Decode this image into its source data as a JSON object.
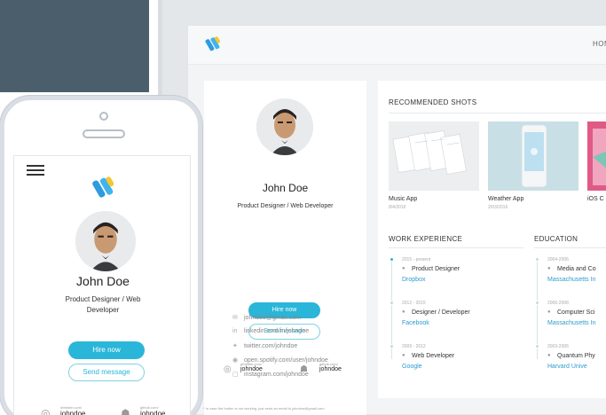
{
  "desktop": {
    "nav_home": "HOME",
    "profile": {
      "name": "John Doe",
      "role": "Product Designer / Web Developer",
      "hire_label": "Hire now",
      "message_label": "Send message",
      "dribbble_caption": "dribbble.com/",
      "dribbble_user": "johndoe",
      "github_caption": "github.com/",
      "github_user": "johndoe"
    },
    "contacts": [
      "johndoe@gmail.com",
      "linkedin.com/in/johndoe",
      "twitter.com/johndoe",
      "open.spotify.com/user/johndoe",
      "instagram.com/johndoe"
    ],
    "recommended_title": "RECOMMENDED SHOTS",
    "shots": [
      {
        "title": "Music App",
        "date": "8/4/2016"
      },
      {
        "title": "Weather App",
        "date": "2/03/2016"
      },
      {
        "title": "iOS C",
        "date": ""
      }
    ],
    "work_title": "WORK EXPERIENCE",
    "work": [
      {
        "dates": "2015 - present",
        "role": "Product Designer",
        "org": "Dropbox"
      },
      {
        "dates": "2012 - 2015",
        "role": "Designer / Developer",
        "org": "Facebook"
      },
      {
        "dates": "2009 - 2012",
        "role": "Web Developer",
        "org": "Google"
      }
    ],
    "education_title": "EDUCATION",
    "education": [
      {
        "dates": "2004-2006",
        "role": "Media and Co",
        "org": "Massachusetts In"
      },
      {
        "dates": "2006-2008",
        "role": "Computer Sci",
        "org": "Massachusetts In"
      },
      {
        "dates": "2003-2006",
        "role": "Quantum Phy",
        "org": "Harvard Unive"
      }
    ],
    "footer_note": "* In case the button is not working, just send an email to johndoe@gmail.com"
  },
  "phone": {
    "name": "John Doe",
    "role": "Product Designer / Web Developer",
    "hire_label": "Hire now",
    "message_label": "Send message",
    "dribbble_caption": "dribbble.com/",
    "dribbble_user": "johndoe",
    "github_caption": "github.com/",
    "github_user": "johndoe"
  },
  "colors": {
    "accent": "#29b6d8",
    "link": "#2b9cd0",
    "slate": "#4a5f6b",
    "logo_blue": "#2e9be0",
    "logo_yellow": "#f6c531"
  },
  "icons": {
    "contacts": [
      "mail-icon",
      "linkedin-icon",
      "twitter-icon",
      "spotify-icon",
      "instagram-icon"
    ],
    "social": [
      "dribbble-icon",
      "github-icon"
    ],
    "menu": "hamburger-menu-icon"
  }
}
